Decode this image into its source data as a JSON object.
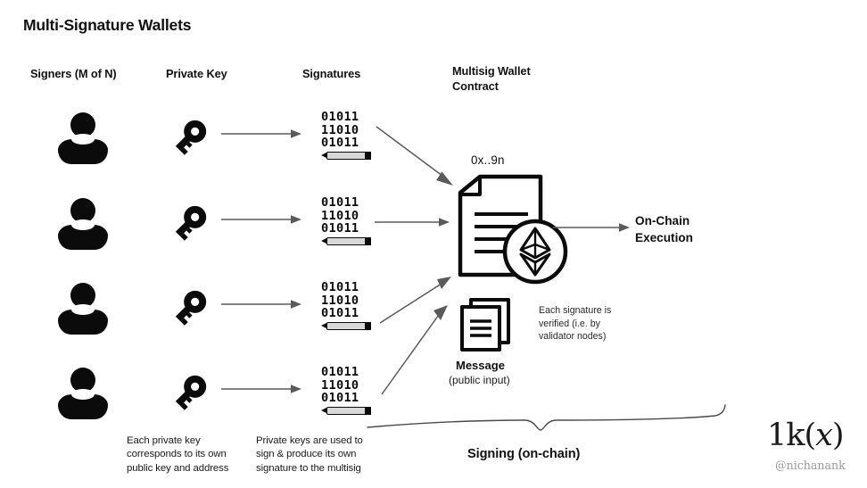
{
  "title": "Multi-Signature Wallets",
  "headers": {
    "signers": "Signers (M of N)",
    "private_key": "Private Key",
    "signatures": "Signatures",
    "contract_line1": "Multisig Wallet",
    "contract_line2": "Contract"
  },
  "signature_rows": [
    {
      "line1": "01011",
      "line2": "11010",
      "line3": "01011"
    },
    {
      "line1": "01011",
      "line2": "11010",
      "line3": "01011"
    },
    {
      "line1": "01011",
      "line2": "11010",
      "line3": "01011"
    },
    {
      "line1": "01011",
      "line2": "11010",
      "line3": "01011"
    }
  ],
  "contract": {
    "address": "0x..9n",
    "chain_icon": "ethereum-icon"
  },
  "message": {
    "label": "Message",
    "sublabel": "(public input)",
    "annotation_line1": "Each signature is",
    "annotation_line2": "verified (i.e. by",
    "annotation_line3": "validator nodes)"
  },
  "execution": {
    "line1": "On-Chain",
    "line2": "Execution"
  },
  "captions": {
    "private_key_note_line1": "Each private key",
    "private_key_note_line2": "corresponds to its own",
    "private_key_note_line3": "public key and address",
    "signature_note_line1": "Private keys are used to",
    "signature_note_line2": "sign & produce its own",
    "signature_note_line3": "signature to the multisig"
  },
  "brace_label": "Signing (on-chain)",
  "watermark": {
    "logo_prefix": "1k(",
    "logo_var": "x",
    "logo_suffix": ")",
    "handle": "@nichanank"
  },
  "colors": {
    "ink": "#0b0b0b",
    "arrow": "#5a5a5a",
    "muted": "#9a9a9a",
    "background": "#ffffff"
  }
}
